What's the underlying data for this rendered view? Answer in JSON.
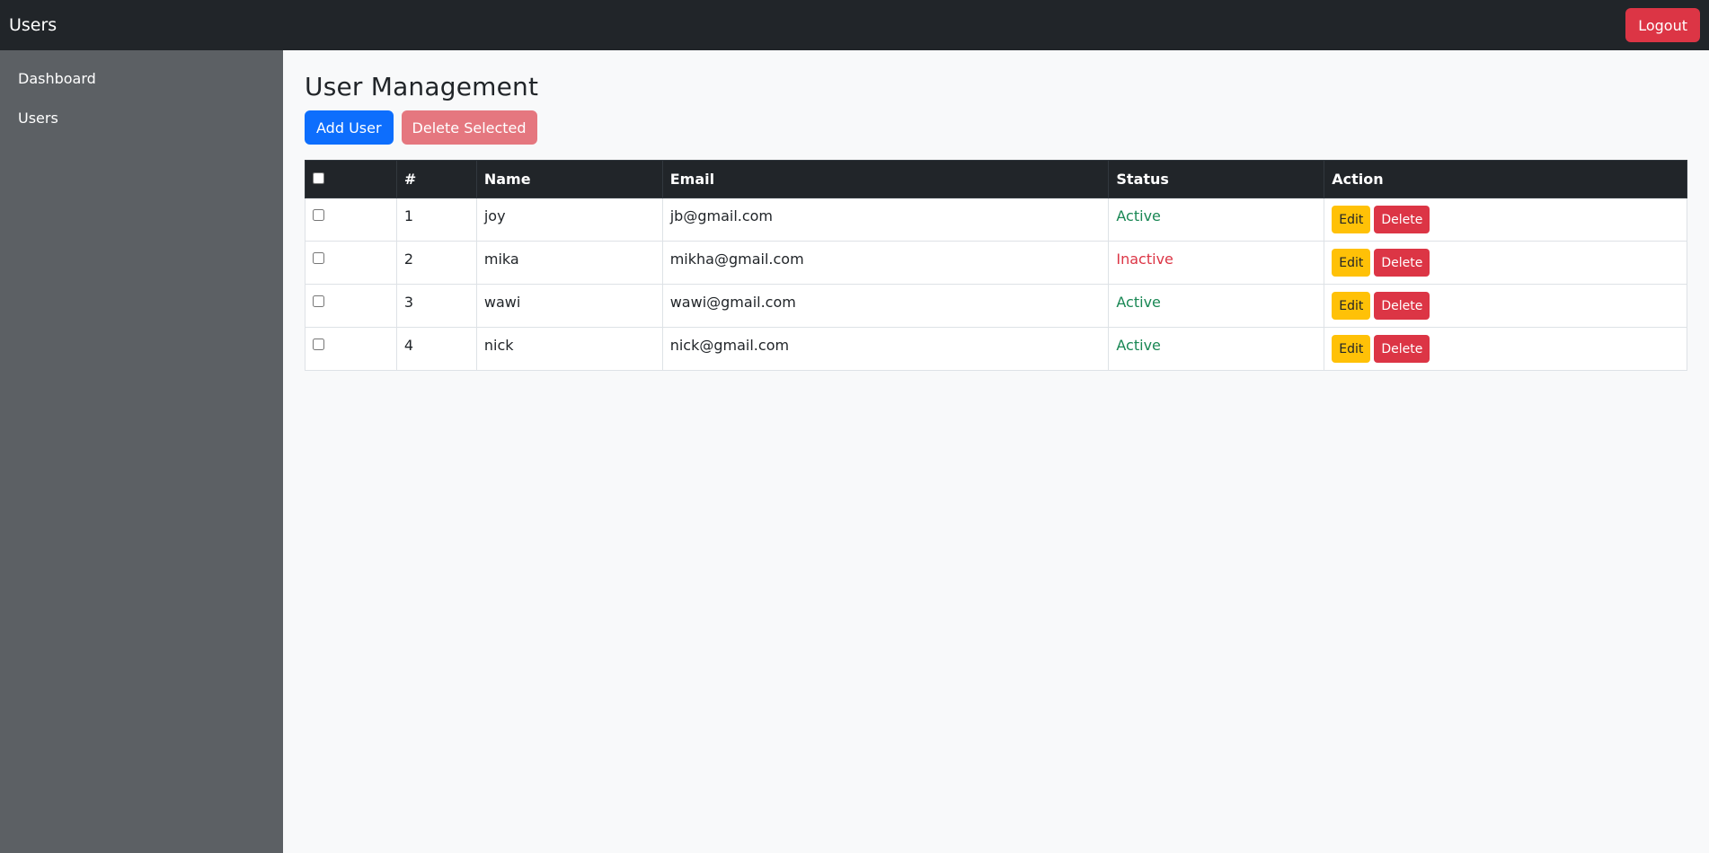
{
  "navbar": {
    "brand": "Users",
    "logout_label": "Logout"
  },
  "sidebar": {
    "items": [
      {
        "label": "Dashboard"
      },
      {
        "label": "Users"
      }
    ]
  },
  "main": {
    "title": "User Management",
    "add_label": "Add User",
    "delete_selected_label": "Delete Selected"
  },
  "table": {
    "headers": [
      "",
      "#",
      "Name",
      "Email",
      "Status",
      "Action"
    ],
    "edit_label": "Edit",
    "delete_label": "Delete",
    "rows": [
      {
        "id": "1",
        "name": "joy",
        "email": "jb@gmail.com",
        "status": "Active"
      },
      {
        "id": "2",
        "name": "mika",
        "email": "mikha@gmail.com",
        "status": "Inactive"
      },
      {
        "id": "3",
        "name": "wawi",
        "email": "wawi@gmail.com",
        "status": "Active"
      },
      {
        "id": "4",
        "name": "nick",
        "email": "nick@gmail.com",
        "status": "Active"
      }
    ]
  },
  "colors": {
    "navbar": "#212529",
    "sidebar": "#5c6064",
    "primary": "#0d6efd",
    "danger": "#dc3545",
    "warning": "#ffc107",
    "success": "#198754"
  }
}
